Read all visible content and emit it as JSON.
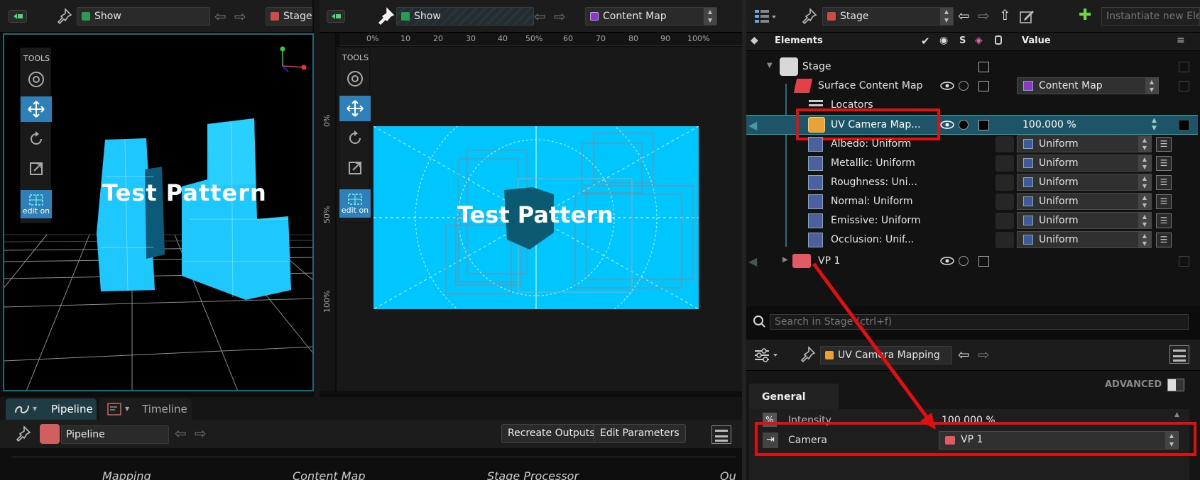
{
  "left_viewport": {
    "pin_field": "Show",
    "stage_field": "Stage",
    "tools_label": "TOOLS",
    "edit_label": "edit on",
    "scene_text": "Test Pattern"
  },
  "middle_viewport": {
    "pin_field": "Show",
    "content_select": "Content Map",
    "tools_label": "TOOLS",
    "edit_label": "edit on",
    "ruler_top": [
      "0%",
      "10",
      "20",
      "30",
      "40",
      "50%",
      "60",
      "70",
      "80",
      "90",
      "100%"
    ],
    "ruler_left": [
      "0%",
      "50%",
      "100%"
    ],
    "canvas_text": "Test Pattern"
  },
  "outliner": {
    "stage_select": "Stage",
    "instantiate_placeholder": "Instantiate new Elem",
    "col_elements": "Elements",
    "col_s": "S",
    "col_value": "Value",
    "rows": [
      {
        "label": "Stage"
      },
      {
        "label": "Surface Content Map",
        "value": "Content Map"
      },
      {
        "label": "Locators"
      },
      {
        "label": "UV Camera Map...",
        "value": "100.000 %"
      },
      {
        "label": "Albedo: Uniform",
        "value": "Uniform"
      },
      {
        "label": "Metallic: Uniform",
        "value": "Uniform"
      },
      {
        "label": "Roughness: Uni...",
        "value": "Uniform"
      },
      {
        "label": "Normal: Uniform",
        "value": "Uniform"
      },
      {
        "label": "Emissive: Uniform",
        "value": "Uniform"
      },
      {
        "label": "Occlusion: Unif...",
        "value": "Uniform"
      },
      {
        "label": "VP 1"
      }
    ],
    "search_placeholder": "Search in Stage (ctrl+f)"
  },
  "properties": {
    "pin_field": "UV Camera Mapping",
    "advanced_label": "ADVANCED",
    "tab_general": "General",
    "params": [
      {
        "label": "Intensity",
        "value": "100.000 %"
      },
      {
        "label": "Camera",
        "value": "VP 1"
      }
    ]
  },
  "bottom": {
    "tab_pipeline": "Pipeline",
    "tab_timeline": "Timeline",
    "pin_field": "Pipeline",
    "recreate_button": "Recreate Outputs",
    "edit_params_button": "Edit Parameters",
    "nodes": [
      "Mapping",
      "Content Map",
      "Stage Processor",
      "Ou"
    ]
  },
  "colors": {
    "accent_blue": "#2f7fb8",
    "cyan": "#00c6ff",
    "highlight_red": "#e01010",
    "selection_teal": "#1e5468"
  }
}
